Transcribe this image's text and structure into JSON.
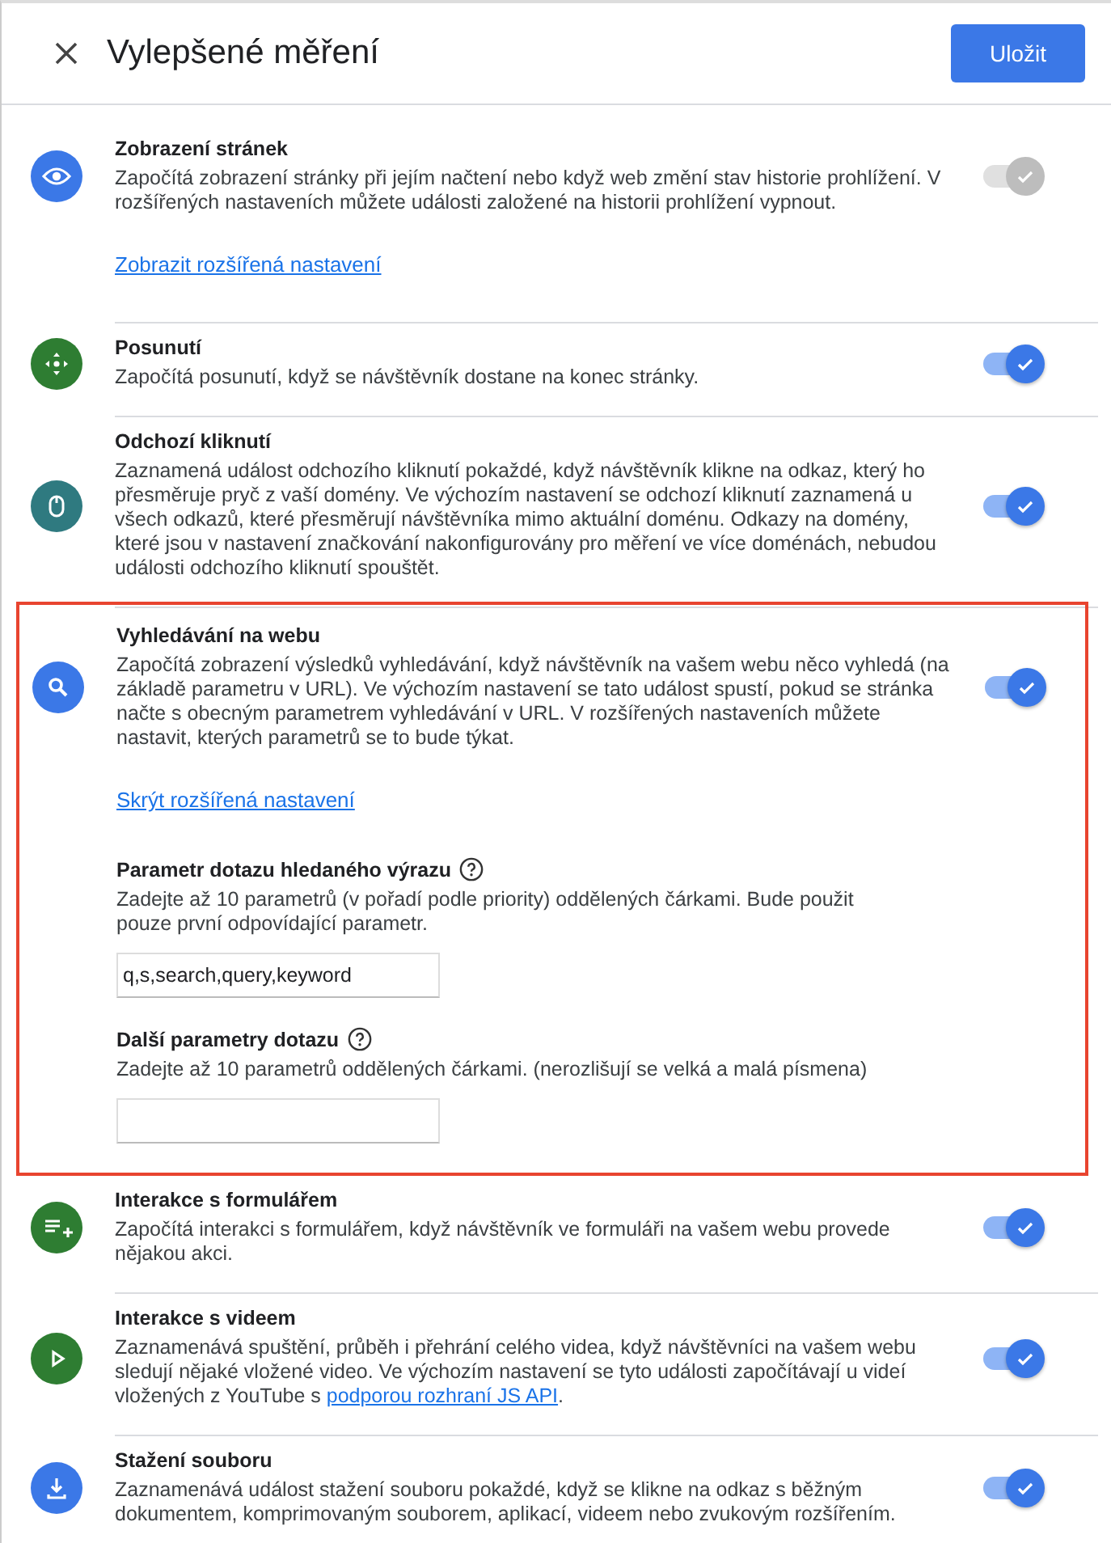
{
  "header": {
    "title": "Vylepšené měření",
    "save_button": "Uložit"
  },
  "settings": [
    {
      "kind": "eye",
      "color": "#3b78e7",
      "title": "Zobrazení stránek",
      "description": "Započítá zobrazení stránky při jejím načtení nebo když web změní stav historie prohlížení. V rozšířených nastaveních můžete události založené na historii prohlížení vypnout.",
      "advanced_link": "Zobrazit rozšířená nastavení",
      "on": true,
      "disabled": true,
      "highlighted": false
    },
    {
      "kind": "scroll",
      "color": "#2e7d32",
      "title": "Posunutí",
      "description": "Započítá posunutí, když se návštěvník dostane na konec stránky.",
      "on": true,
      "disabled": false,
      "highlighted": false
    },
    {
      "kind": "mouse",
      "color": "#2f7a80",
      "title": "Odchozí kliknutí",
      "description": "Zaznamená událost odchozího kliknutí pokaždé, když návštěvník klikne na odkaz, který ho přesměruje pryč z vaší domény. Ve výchozím nastavení se odchozí kliknutí zaznamená u všech odkazů, které přesměrují návštěvníka mimo aktuální doménu. Odkazy na domény, které jsou v nastavení značkování nakonfigurovány pro měření ve více doménách, nebudou události odchozího kliknutí spouštět.",
      "on": true,
      "disabled": false,
      "highlighted": false
    },
    {
      "kind": "search",
      "color": "#3b78e7",
      "title": "Vyhledávání na webu",
      "description": "Započítá zobrazení výsledků vyhledávání, když návštěvník na vašem webu něco vyhledá (na základě parametru v URL). Ve výchozím nastavení se tato událost spustí, pokud se stránka načte s obecným parametrem vyhledávání v URL. V rozšířených nastaveních můžete nastavit, kterých parametrů se to bude týkat.",
      "advanced_link": "Skrýt rozšířená nastavení",
      "fields": [
        {
          "label": "Parametr dotazu hledaného výrazu",
          "hint": "Zadejte až 10 parametrů (v pořadí podle priority) oddělených čárkami. Bude použit pouze první odpovídající parametr.",
          "value": "q,s,search,query,keyword"
        },
        {
          "label": "Další parametry dotazu",
          "hint": "Zadejte až 10 parametrů oddělených čárkami. (nerozlišují se velká a malá písmena)"
        }
      ],
      "on": true,
      "disabled": false,
      "highlighted": true
    },
    {
      "kind": "form",
      "color": "#2e7d32",
      "title": "Interakce s formulářem",
      "description": "Započítá interakci s formulářem, když návštěvník ve formuláři na vašem webu provede nějakou akci.",
      "on": true,
      "disabled": false,
      "highlighted": false
    },
    {
      "kind": "play",
      "color": "#2e7d32",
      "title": "Interakce s videem",
      "description": "Zaznamenává spuštění, průběh i přehrání celého videa, když návštěvníci na vašem webu sledují nějaké vložené video. Ve výchozím nastavení se tyto události započítávají u videí vložených z YouTube s ",
      "link": "podporou rozhraní JS API",
      "description_end": ".",
      "on": true,
      "disabled": false,
      "highlighted": false
    },
    {
      "kind": "download",
      "color": "#3b78e7",
      "title": "Stažení souboru",
      "description": "Zaznamenává událost stažení souboru pokaždé, když se klikne na odkaz s běžným dokumentem, komprimovaným souborem, aplikací, videem nebo zvukovým rozšířením.",
      "on": true,
      "disabled": false,
      "highlighted": false
    }
  ]
}
